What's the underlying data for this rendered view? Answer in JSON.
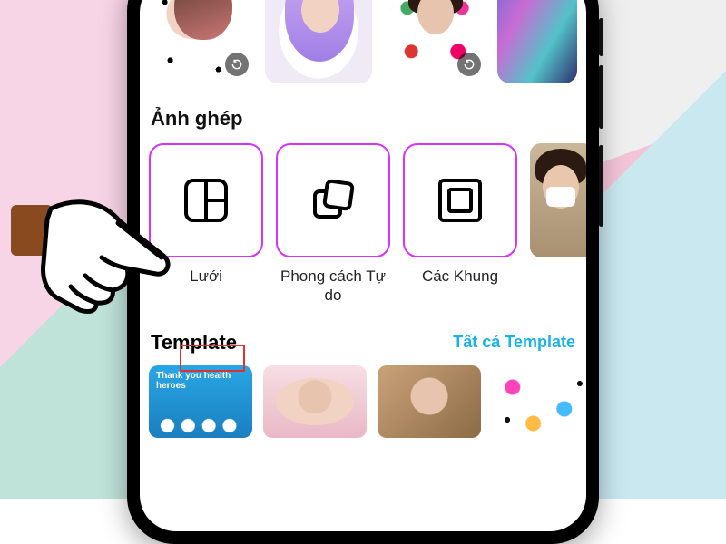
{
  "sections": {
    "collage_title": "Ảnh ghép",
    "template_title": "Template",
    "template_all": "Tất cả Template"
  },
  "collage": {
    "items": [
      {
        "label": "Lưới",
        "icon": "grid"
      },
      {
        "label": "Phong cách Tự do",
        "icon": "freestyle"
      },
      {
        "label": "Các Khung",
        "icon": "frames"
      }
    ]
  },
  "templates": {
    "cards": [
      {
        "caption": "Thank you health heroes"
      },
      {
        "caption": ""
      },
      {
        "caption": ""
      },
      {
        "caption": ""
      }
    ]
  },
  "highlight": {
    "target": "Lưới"
  },
  "colors": {
    "accent": "#d633ff",
    "link": "#17b3e6",
    "highlight": "#e03131"
  }
}
